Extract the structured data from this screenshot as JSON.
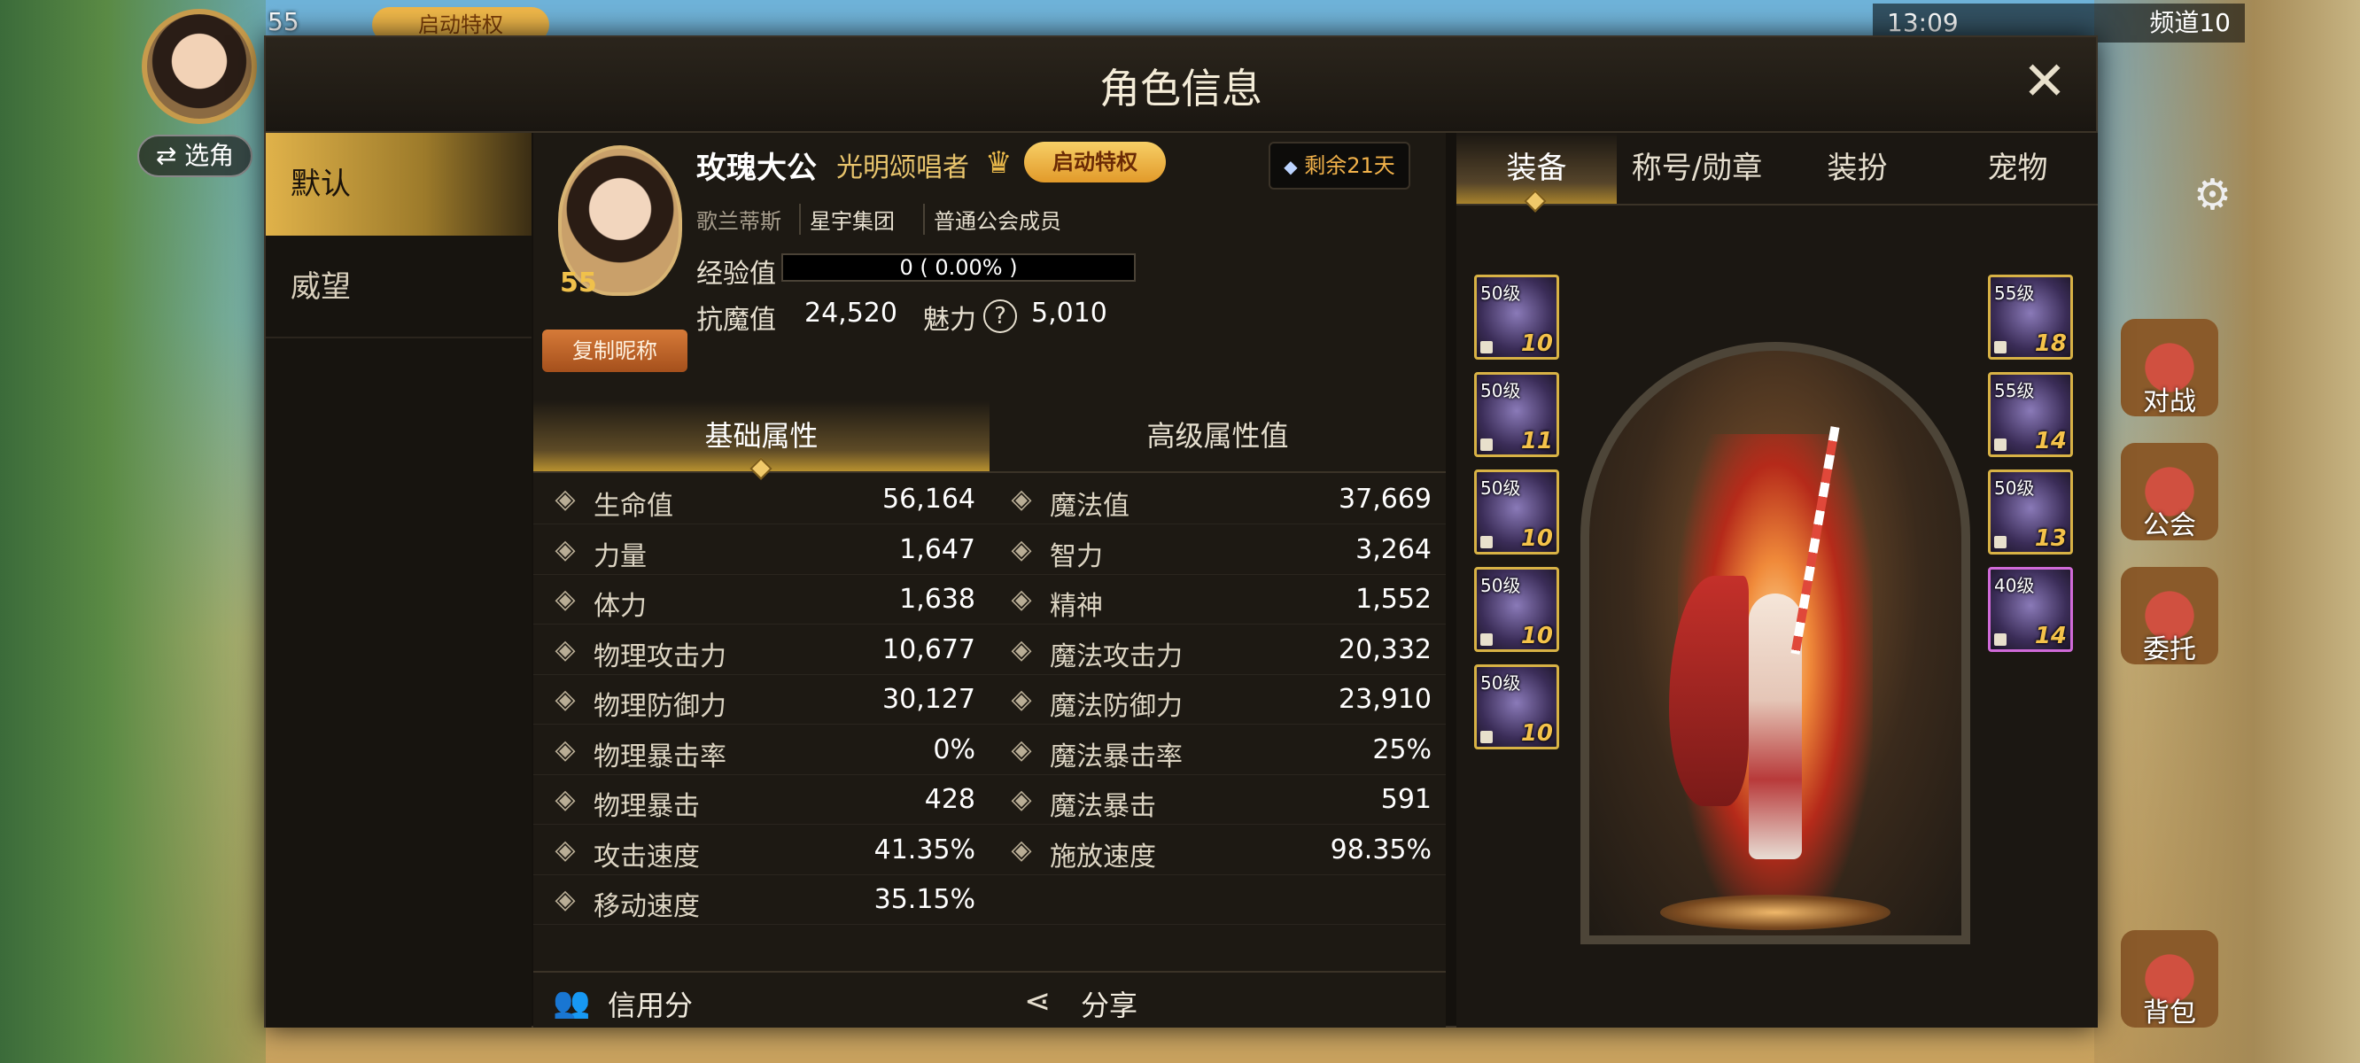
{
  "background": {
    "level": "55",
    "privilege_badge": "启动特权",
    "select_role_button": "⇄ 选角",
    "status_time": "13:09",
    "status_channel": "频道10",
    "side_buttons": [
      "对战",
      "公会",
      "委托",
      "背包"
    ]
  },
  "modal": {
    "title": "角色信息",
    "close_icon": "close-icon"
  },
  "nav": {
    "items": [
      {
        "label": "默认",
        "active": true
      },
      {
        "label": "威望",
        "active": false
      }
    ]
  },
  "profile": {
    "level": "55",
    "copy_button": "复制昵称",
    "name": "玫瑰大公",
    "title": "光明颂唱者",
    "vip_badge": "启动特权",
    "days_left": "剩余21天",
    "server": "歌兰蒂斯",
    "guild": "星宇集团",
    "guild_role": "普通公会成员",
    "exp_label": "经验值",
    "exp_text": "0 ( 0.00% )",
    "exp_fraction": 0.0,
    "resist_label": "抗魔值",
    "resist_value": "24,520",
    "charm_label": "魅力",
    "charm_value": "5,010"
  },
  "subtabs": [
    {
      "label": "基础属性",
      "active": true
    },
    {
      "label": "高级属性值",
      "active": false
    }
  ],
  "stats": [
    {
      "left": {
        "icon": "heart-icon",
        "name": "生命值",
        "value": "56,164"
      },
      "right": {
        "icon": "heart-outline-icon",
        "name": "魔法值",
        "value": "37,669"
      }
    },
    {
      "left": {
        "icon": "arm-icon",
        "name": "力量",
        "value": "1,647"
      },
      "right": {
        "icon": "brain-icon",
        "name": "智力",
        "value": "3,264"
      }
    },
    {
      "left": {
        "icon": "body-icon",
        "name": "体力",
        "value": "1,638"
      },
      "right": {
        "icon": "spirit-icon",
        "name": "精神",
        "value": "1,552"
      }
    },
    {
      "left": {
        "icon": "sword-icon",
        "name": "物理攻击力",
        "value": "10,677"
      },
      "right": {
        "icon": "magic-burst-icon",
        "name": "魔法攻击力",
        "value": "20,332"
      }
    },
    {
      "left": {
        "icon": "shield-icon",
        "name": "物理防御力",
        "value": "30,127"
      },
      "right": {
        "icon": "magic-shield-icon",
        "name": "魔法防御力",
        "value": "23,910"
      }
    },
    {
      "left": {
        "icon": "crosshair-icon",
        "name": "物理暴击率",
        "value": "0%"
      },
      "right": {
        "icon": "target-icon",
        "name": "魔法暴击率",
        "value": "25%"
      }
    },
    {
      "left": {
        "icon": "crosshair-icon",
        "name": "物理暴击",
        "value": "428"
      },
      "right": {
        "icon": "target-icon",
        "name": "魔法暴击",
        "value": "591"
      }
    },
    {
      "left": {
        "icon": "attack-speed-icon",
        "name": "攻击速度",
        "value": "41.35%"
      },
      "right": {
        "icon": "cast-speed-icon",
        "name": "施放速度",
        "value": "98.35%"
      }
    },
    {
      "left": {
        "icon": "boot-icon",
        "name": "移动速度",
        "value": "35.15%"
      },
      "right": null
    }
  ],
  "bottom": {
    "credit_label": "信用分",
    "share_label": "分享"
  },
  "right_tabs": [
    {
      "label": "装备",
      "active": true
    },
    {
      "label": "称号/勋章",
      "active": false
    },
    {
      "label": "装扮",
      "active": false
    },
    {
      "label": "宠物",
      "active": false
    }
  ],
  "equipment_left": [
    {
      "level": "50级",
      "enhance": "10"
    },
    {
      "level": "50级",
      "enhance": "11"
    },
    {
      "level": "50级",
      "enhance": "10"
    },
    {
      "level": "50级",
      "enhance": "10"
    },
    {
      "level": "50级",
      "enhance": "10"
    }
  ],
  "equipment_right": [
    {
      "level": "55级",
      "enhance": "18"
    },
    {
      "level": "55级",
      "enhance": "14"
    },
    {
      "level": "50级",
      "enhance": "13"
    },
    {
      "level": "40级",
      "enhance": "14"
    }
  ]
}
